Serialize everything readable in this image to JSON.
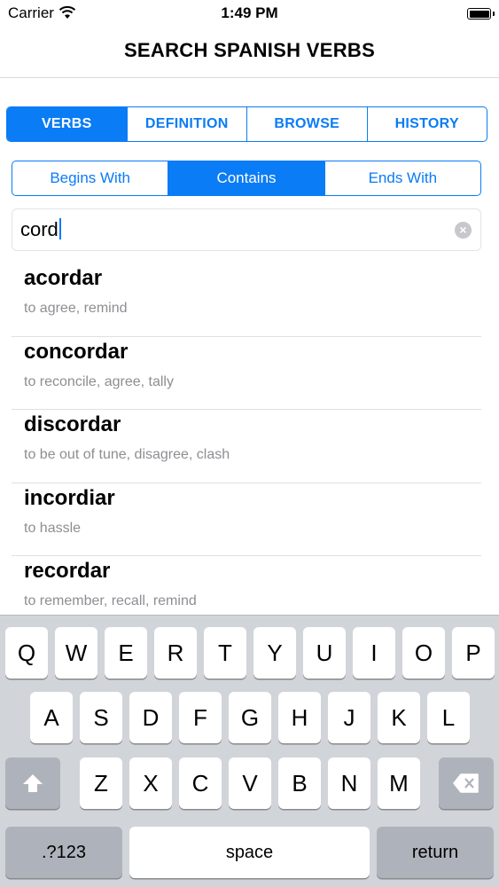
{
  "status_bar": {
    "carrier": "Carrier",
    "time": "1:49 PM"
  },
  "nav": {
    "title": "SEARCH SPANISH VERBS"
  },
  "main_tabs": [
    {
      "label": "VERBS",
      "active": true
    },
    {
      "label": "DEFINITION",
      "active": false
    },
    {
      "label": "BROWSE",
      "active": false
    },
    {
      "label": "HISTORY",
      "active": false
    }
  ],
  "filter_tabs": [
    {
      "label": "Begins With",
      "active": false
    },
    {
      "label": "Contains",
      "active": true
    },
    {
      "label": "Ends With",
      "active": false
    }
  ],
  "search": {
    "value": "cord",
    "clear_icon": "×"
  },
  "results": [
    {
      "verb": "acordar",
      "definition": "to agree, remind"
    },
    {
      "verb": "concordar",
      "definition": "to reconcile, agree, tally"
    },
    {
      "verb": "discordar",
      "definition": "to be out of tune, disagree, clash"
    },
    {
      "verb": "incordiar",
      "definition": "to hassle"
    },
    {
      "verb": "recordar",
      "definition": "to remember, recall, remind"
    }
  ],
  "keyboard": {
    "row1": [
      "Q",
      "W",
      "E",
      "R",
      "T",
      "Y",
      "U",
      "I",
      "O",
      "P"
    ],
    "row2": [
      "A",
      "S",
      "D",
      "F",
      "G",
      "H",
      "J",
      "K",
      "L"
    ],
    "row3": [
      "Z",
      "X",
      "C",
      "V",
      "B",
      "N",
      "M"
    ],
    "numbers_label": ".?123",
    "space_label": "space",
    "return_label": "return"
  },
  "colors": {
    "accent": "#0a7cf5"
  }
}
